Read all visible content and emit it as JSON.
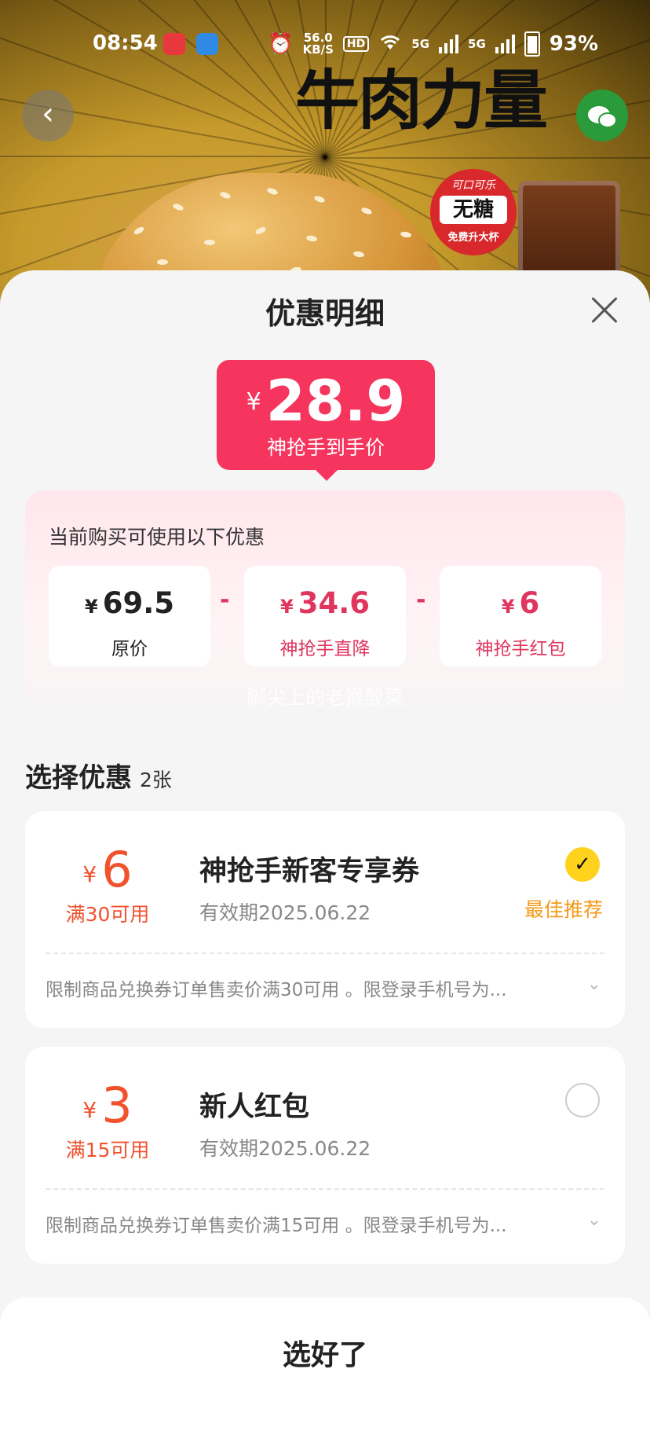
{
  "status_bar": {
    "time": "08:54",
    "network_speed": "56.0",
    "network_unit": "KB/S",
    "hd_label": "HD",
    "signal_1": "5G",
    "signal_2": "5G",
    "battery": "93%"
  },
  "banner": {
    "headline": "牛肉力量",
    "promo_badge_top": "可口可乐",
    "promo_badge_main": "无糖",
    "promo_badge_bottom": "免费升大杯"
  },
  "sheet": {
    "title": "优惠明细",
    "final_price": {
      "currency": "¥",
      "amount": "28.9",
      "label": "神抢手到手价"
    },
    "deductions": {
      "title": "当前购买可使用以下优惠",
      "items": [
        {
          "currency": "¥",
          "amount": "69.5",
          "label": "原价"
        },
        {
          "currency": "¥",
          "amount": "34.6",
          "label": "神抢手直降"
        },
        {
          "currency": "¥",
          "amount": "6",
          "label": "神抢手红包"
        }
      ],
      "operator": "-"
    },
    "watermark": "脚尖上的老猴酸菜",
    "select_section": {
      "title": "选择优惠",
      "count": "2张"
    },
    "coupons": [
      {
        "currency": "¥",
        "amount": "6",
        "condition": "满30可用",
        "name": "神抢手新客专享券",
        "validity": "有效期2025.06.22",
        "selected": true,
        "tag": "最佳推荐",
        "description": "限制商品兑换券订单售卖价满30可用 。限登录手机号为..."
      },
      {
        "currency": "¥",
        "amount": "3",
        "condition": "满15可用",
        "name": "新人红包",
        "validity": "有效期2025.06.22",
        "selected": false,
        "tag": "",
        "description": "限制商品兑换券订单售卖价满15可用 。限登录手机号为..."
      }
    ],
    "confirm_label": "选好了"
  },
  "colors": {
    "accent_pink": "#f6355e",
    "coupon_orange": "#f0522e",
    "best_tag": "#f39a1a",
    "check_yellow": "#ffd21e"
  },
  "icons": {
    "back": "chevron-left-icon",
    "share": "wechat-icon",
    "close": "close-icon",
    "expand": "chevron-down-icon",
    "selected": "check-icon"
  }
}
